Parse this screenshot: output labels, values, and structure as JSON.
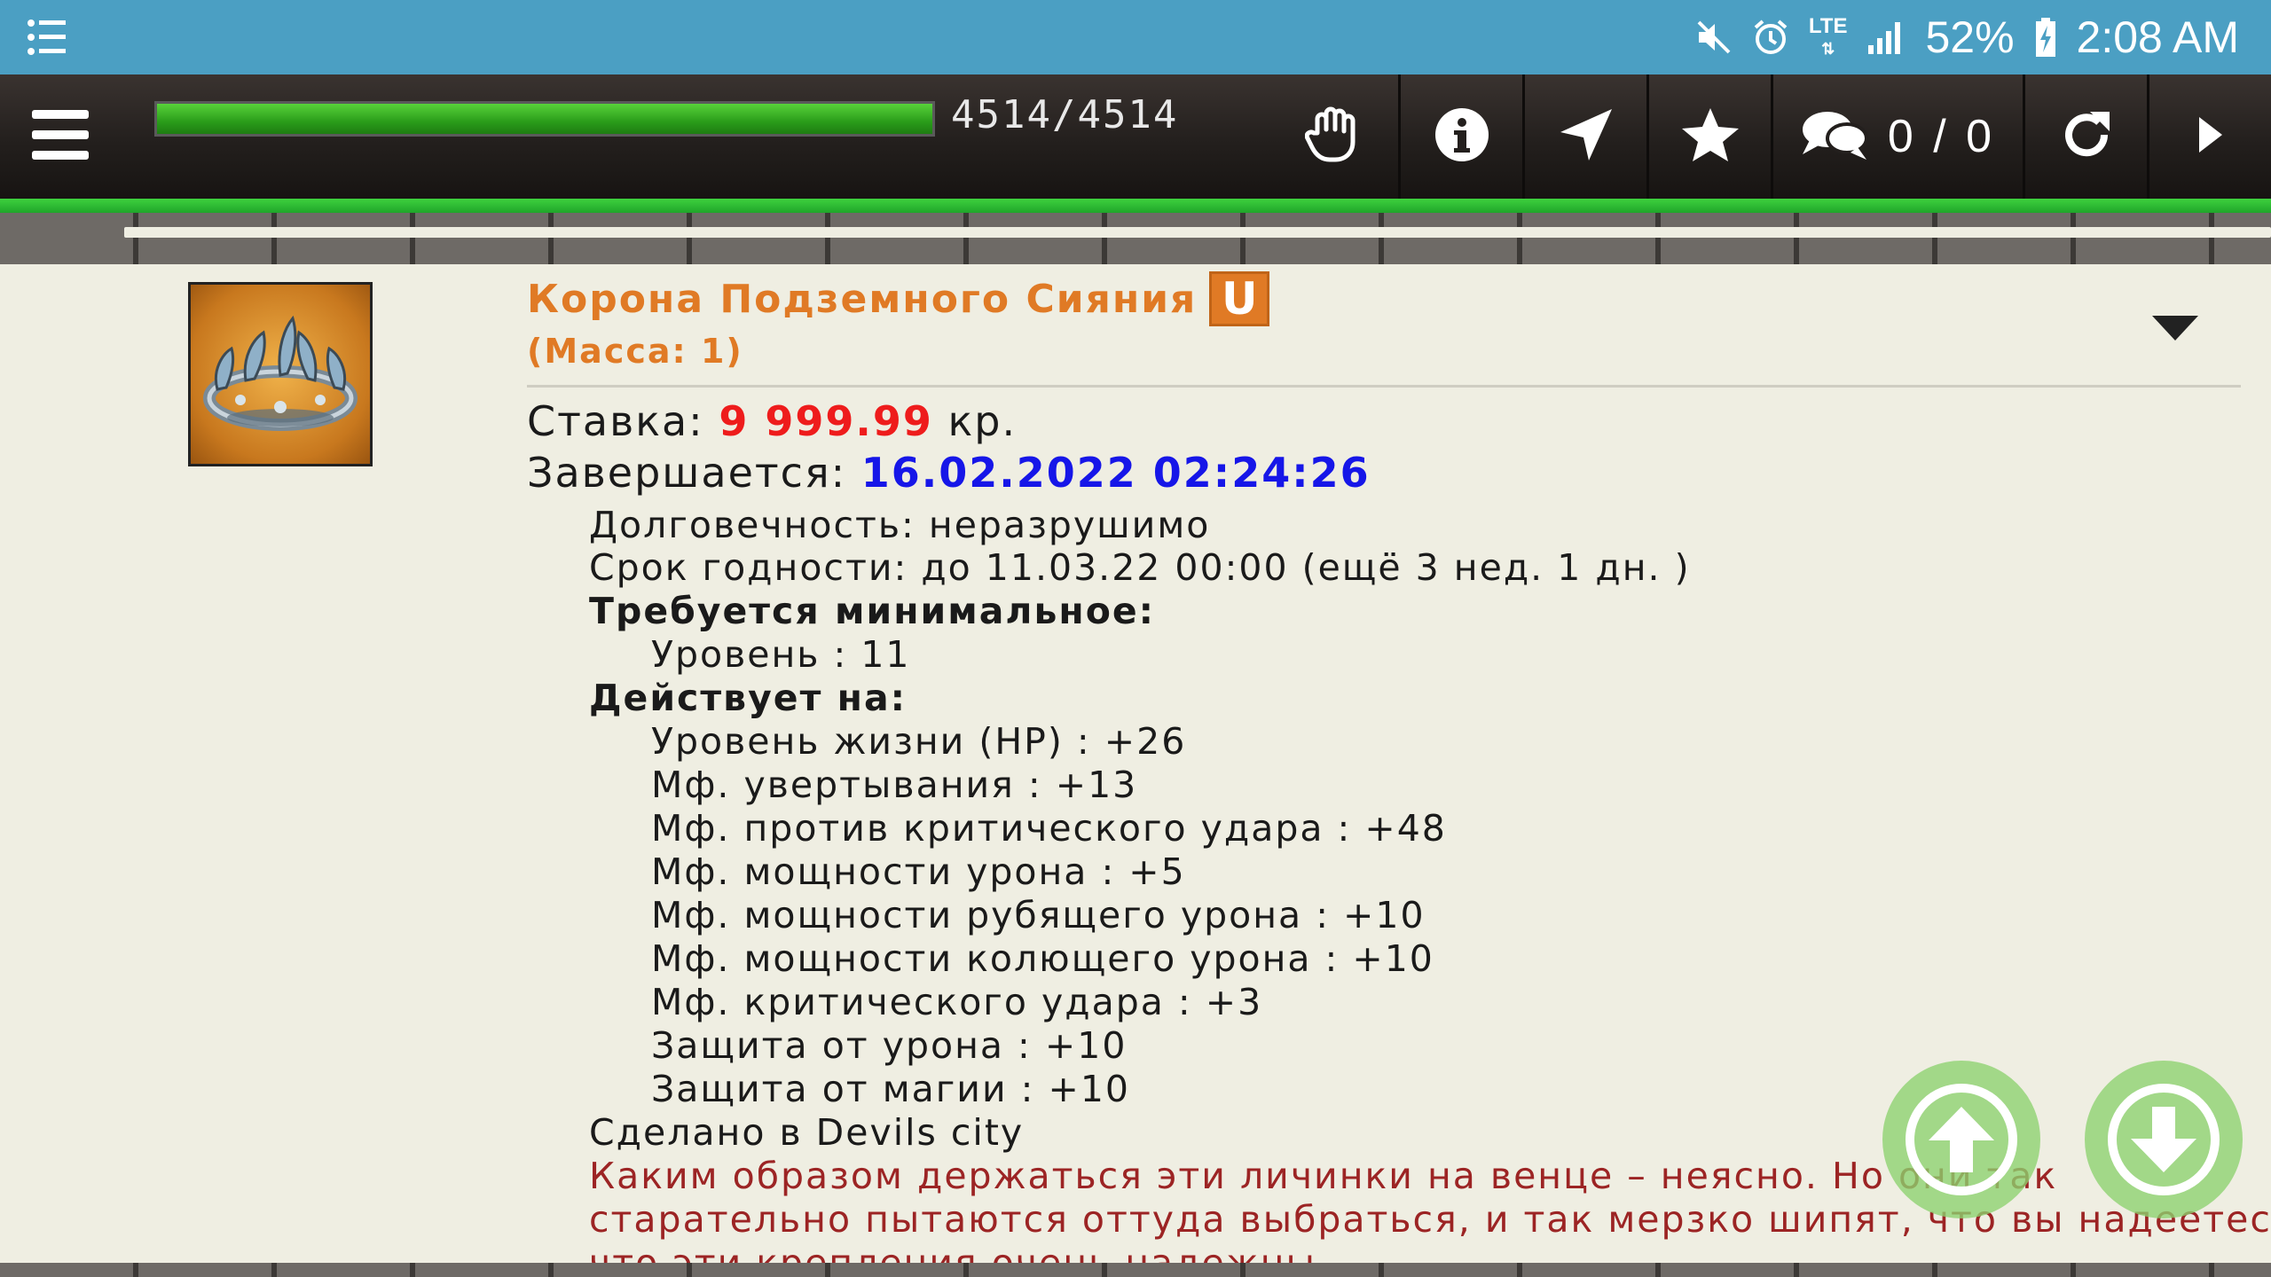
{
  "status_bar": {
    "battery": "52%",
    "time": "2:08 AM",
    "network": "LTE",
    "icons": [
      "notification-list-icon",
      "mute-icon",
      "alarm-icon",
      "lte-icon",
      "signal-icon",
      "battery-charging-icon"
    ]
  },
  "toolbar": {
    "hp_text": "4514/4514",
    "hp_fraction": 1.0,
    "chat_count": "0 / 0",
    "icons": [
      "menu-icon",
      "hand-icon",
      "info-icon",
      "navigate-icon",
      "star-icon",
      "chat-icon",
      "refresh-icon",
      "play-icon"
    ]
  },
  "item": {
    "name": "Корона Подземного Сияния",
    "badge": "U",
    "mass": "(Масса: 1)",
    "bid_label": "Ставка:",
    "bid_value": "9 999.99",
    "bid_unit": "кр.",
    "ends_label": "Завершается:",
    "ends_value": "16.02.2022 02:24:26",
    "durability": "Долговечность: неразрушимо",
    "expiry": "Срок годности: до 11.03.22 00:00 (ещё 3 нед. 1 дн. )",
    "requires_header": "Требуется минимальное:",
    "requires": [
      "Уровень : 11"
    ],
    "effects_header": "Действует на:",
    "effects": [
      "Уровень жизни (HP) : +26",
      "Мф. увертывания : +13",
      "Мф. против критического удара : +48",
      "Мф. мощности урона : +5",
      "Мф. мощности рубящего урона : +10",
      "Мф. мощности колющего урона : +10",
      "Мф. критического удара : +3",
      "Защита от урона : +10",
      "Защита от магии : +10"
    ],
    "made_in": "Сделано в Devils city",
    "description": [
      "Каким образом держаться эти личинки на венце – неясно. Но они так",
      "старательно пытаются оттуда выбраться, и так мерзко шипят, что вы надеетесь,",
      "что эти крепления очень надежны."
    ]
  },
  "colors": {
    "status_bar": "#4b9fc3",
    "title": "#e07a25",
    "bid": "#ee1c1c",
    "date": "#1616e8",
    "description": "#9c2424",
    "scroll_buttons": "#8cd26e"
  }
}
